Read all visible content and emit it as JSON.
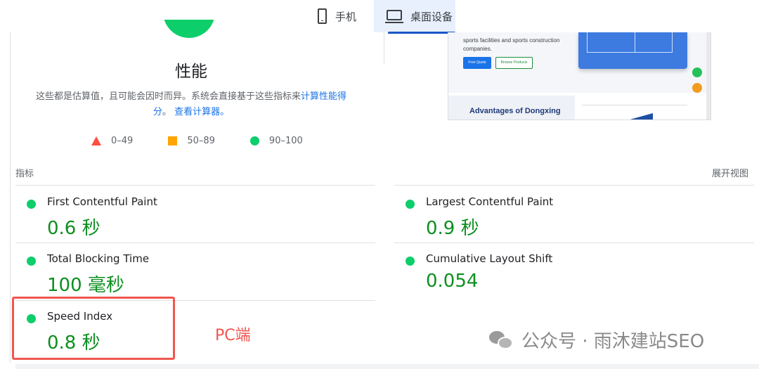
{
  "tabs": {
    "mobile_label": "手机",
    "desktop_label": "桌面设备"
  },
  "performance": {
    "title": "性能",
    "description": "这些都是估算值，且可能会因时而异。系统会直接基于这些指标来",
    "calc_link": "计算性能得分",
    "separator": "。",
    "calculator_link": "查看计算器。"
  },
  "legend": [
    {
      "label": "0–49",
      "color": "#ff4e42"
    },
    {
      "label": "50–89",
      "color": "#ffa400"
    },
    {
      "label": "90–100",
      "color": "#0cce6b"
    }
  ],
  "thumbnail": {
    "text": "sports facilities and sports construction companies.",
    "btn_quote": "Free Quote",
    "btn_browse": "Browse Products",
    "heading": "Advantages of Dongxing"
  },
  "metrics_header": {
    "label": "指标",
    "expand": "展开视图"
  },
  "metrics": [
    {
      "name": "First Contentful Paint",
      "value": "0.6 秒",
      "status_color": "#0cce6b"
    },
    {
      "name": "Largest Contentful Paint",
      "value": "0.9 秒",
      "status_color": "#0cce6b"
    },
    {
      "name": "Total Blocking Time",
      "value": "100 毫秒",
      "status_color": "#0cce6b"
    },
    {
      "name": "Cumulative Layout Shift",
      "value": "0.054",
      "status_color": "#0cce6b"
    },
    {
      "name": "Speed Index",
      "value": "0.8 秒",
      "status_color": "#0cce6b"
    }
  ],
  "annotation": {
    "label": "PC端"
  },
  "watermark": {
    "text": "公众号 · 雨沐建站SEO"
  },
  "colors": {
    "good": "#0cce6b",
    "value_text": "#0d8f1f",
    "accent_blue": "#1a73e8",
    "annotation_red": "#f0564f"
  }
}
